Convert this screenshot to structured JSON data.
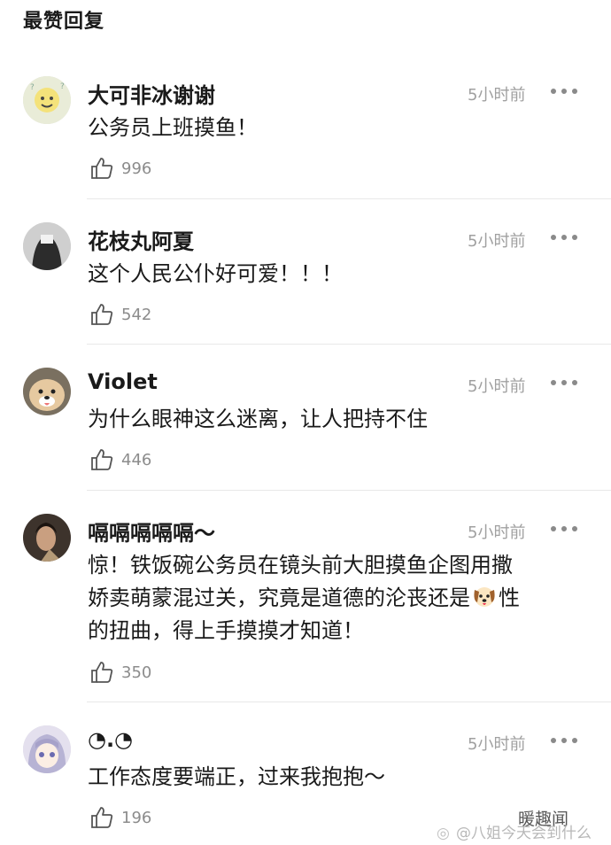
{
  "header": {
    "title": "最赞回复"
  },
  "comments": [
    {
      "name": "大可非冰谢谢",
      "time": "5小时前",
      "text": "公务员上班摸鱼！",
      "likes": "996"
    },
    {
      "name": "花枝丸阿夏",
      "time": "5小时前",
      "text": "这个人民公仆好可爱！！！",
      "likes": "542"
    },
    {
      "name": "Violet",
      "time": "5小时前",
      "text": "为什么眼神这么迷离，让人把持不住",
      "likes": "446"
    },
    {
      "name": "嗝嗝嗝嗝嗝～",
      "time": "5小时前",
      "text_line1": "惊！铁饭碗公务员在镜头前大胆摸鱼企图用撒",
      "text_line2a": "娇卖萌蒙混过关，究竟是道德的沦丧还是",
      "text_line2b": "性",
      "text_line3": "的扭曲，得上手摸摸才知道！",
      "likes": "350"
    },
    {
      "name": "◔.◔",
      "time": "5小时前",
      "text": "工作态度要端正，过来我抱抱～",
      "likes": "196"
    }
  ],
  "watermark": {
    "text": "@八姐今天会到什么",
    "brand": "暖趣闻"
  },
  "colors": {
    "time": "#a0a0a0",
    "likes": "#8c8c8c",
    "divider": "#e8e8e8"
  }
}
